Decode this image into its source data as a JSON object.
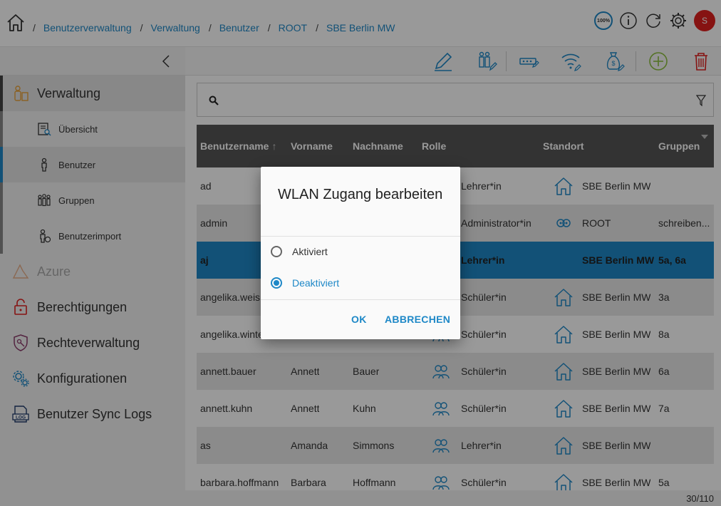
{
  "breadcrumb": [
    "Benutzerverwaltung",
    "Verwaltung",
    "Benutzer",
    "ROOT",
    "SBE Berlin MW"
  ],
  "header": {
    "zoom": "100%",
    "avatar_initial": "S",
    "avatar_color": "#e0201f"
  },
  "accent_color": "#1e88c7",
  "sidebar": {
    "items": [
      {
        "label": "Verwaltung",
        "icon": "user-admin-icon"
      },
      {
        "label": "Azure",
        "icon": "azure-icon"
      },
      {
        "label": "Berechtigungen",
        "icon": "lock-icon"
      },
      {
        "label": "Rechteverwaltung",
        "icon": "shield-key-icon"
      },
      {
        "label": "Konfigurationen",
        "icon": "gears-icon"
      },
      {
        "label": "Benutzer Sync Logs",
        "icon": "log-icon"
      }
    ],
    "sub_items": [
      {
        "label": "Übersicht",
        "icon": "overview-icon"
      },
      {
        "label": "Benutzer",
        "icon": "user-icon"
      },
      {
        "label": "Gruppen",
        "icon": "group-icon"
      },
      {
        "label": "Benutzerimport",
        "icon": "user-import-icon"
      }
    ]
  },
  "search": {
    "placeholder": ""
  },
  "table": {
    "columns": [
      "Benutzername",
      "Vorname",
      "Nachname",
      "Rolle",
      "Standort",
      "Gruppen"
    ],
    "rows": [
      {
        "username": "ad",
        "first": "",
        "last": "",
        "role": "Lehrer*in",
        "location": "SBE Berlin MW",
        "groups": ""
      },
      {
        "username": "admin",
        "first": "",
        "last": "",
        "role": "Administrator*in",
        "location": "ROOT",
        "groups": "schreiben..."
      },
      {
        "username": "aj",
        "first": "",
        "last": "",
        "role": "Lehrer*in",
        "location": "SBE Berlin MW",
        "groups": "5a, 6a"
      },
      {
        "username": "angelika.weis",
        "first": "",
        "last": "",
        "role": "Schüler*in",
        "location": "SBE Berlin MW",
        "groups": "3a"
      },
      {
        "username": "angelika.winte",
        "first": "",
        "last": "",
        "role": "Schüler*in",
        "location": "SBE Berlin MW",
        "groups": "8a"
      },
      {
        "username": "annett.bauer",
        "first": "Annett",
        "last": "Bauer",
        "role": "Schüler*in",
        "location": "SBE Berlin MW",
        "groups": "6a"
      },
      {
        "username": "annett.kuhn",
        "first": "Annett",
        "last": "Kuhn",
        "role": "Schüler*in",
        "location": "SBE Berlin MW",
        "groups": "7a"
      },
      {
        "username": "as",
        "first": "Amanda",
        "last": "Simmons",
        "role": "Lehrer*in",
        "location": "SBE Berlin MW",
        "groups": ""
      },
      {
        "username": "barbara.hoffmann",
        "first": "Barbara",
        "last": "Hoffmann",
        "role": "Schüler*in",
        "location": "SBE Berlin MW",
        "groups": "5a"
      }
    ]
  },
  "footer": {
    "count": "30/110"
  },
  "dialog": {
    "title": "WLAN Zugang bearbeiten",
    "option_active": "Aktiviert",
    "option_inactive": "Deaktiviert",
    "ok": "OK",
    "cancel": "ABBRECHEN"
  }
}
